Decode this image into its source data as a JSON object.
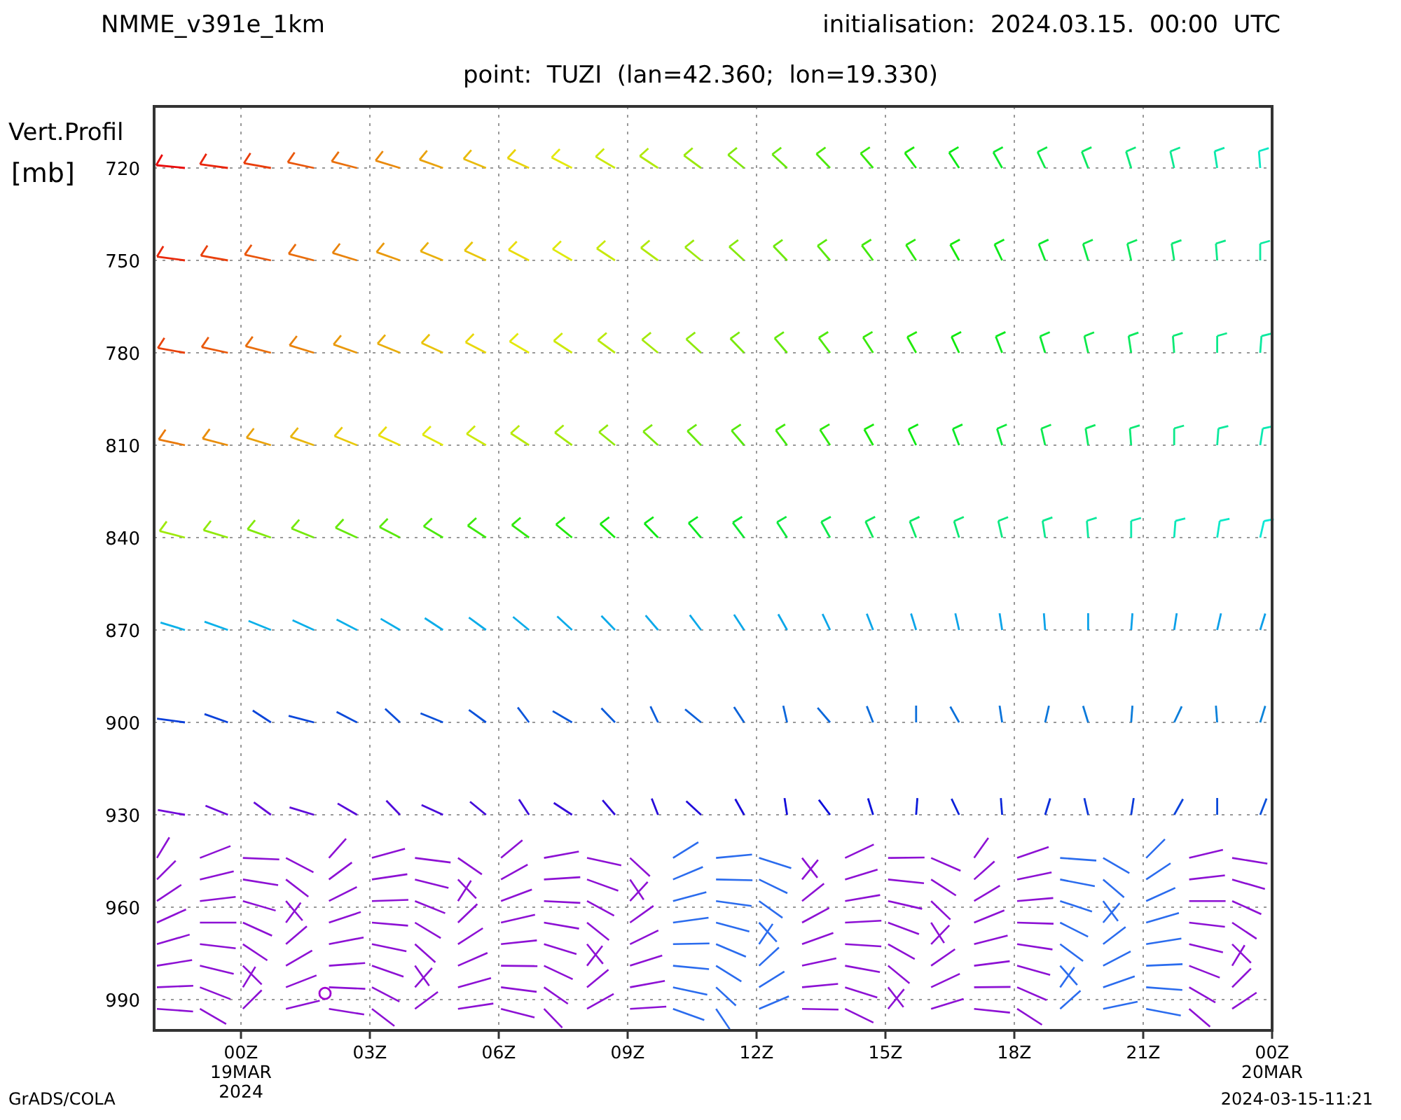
{
  "header": {
    "model": "NMME_v391e_1km",
    "initialisation": "initialisation:  2024.03.15.  00:00  UTC"
  },
  "subtitle": "point:  TUZI  (lan=42.360;  lon=19.330)",
  "plot": {
    "ylabel": [
      "Vert.Profil",
      "[mb]"
    ],
    "yticks": [
      "720",
      "750",
      "780",
      "810",
      "840",
      "870",
      "900",
      "930",
      "960",
      "990"
    ],
    "xticks": [
      {
        "label": "00Z",
        "date": [
          "19MAR",
          "2024"
        ]
      },
      {
        "label": "03Z"
      },
      {
        "label": "06Z"
      },
      {
        "label": "09Z"
      },
      {
        "label": "12Z"
      },
      {
        "label": "15Z"
      },
      {
        "label": "18Z"
      },
      {
        "label": "21Z"
      },
      {
        "label": "00Z",
        "date": [
          "20MAR"
        ]
      }
    ]
  },
  "footer": {
    "left": "GrADS/COLA",
    "right": "2024-03-15-11:21"
  }
}
